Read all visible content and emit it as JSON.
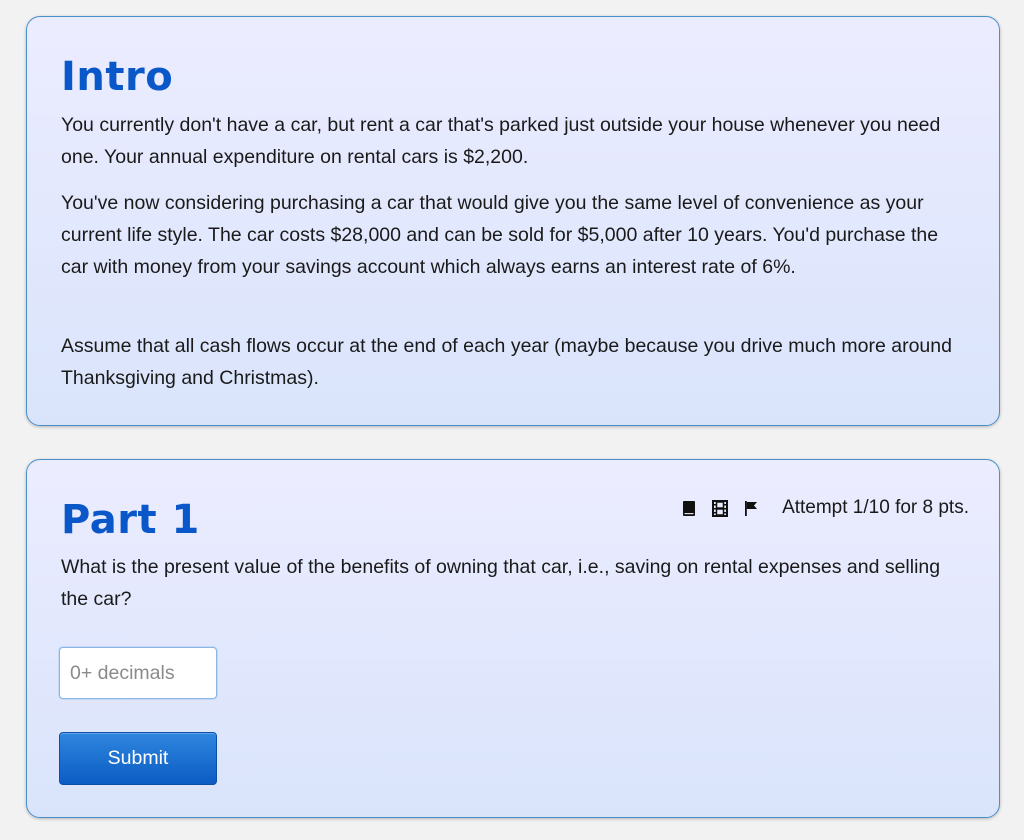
{
  "intro": {
    "title": "Intro",
    "paragraphs": [
      "You currently don't have a car, but rent a car that's parked just outside your house whenever you need one. Your annual expenditure on rental cars is $2,200.",
      "You've now considering purchasing a car that would give you the same level of convenience as your current life style. The car costs $28,000 and can be sold for $5,000 after 10 years. You'd purchase the car with money from your savings account which always earns an interest rate of 6%.",
      "Assume that all cash flows occur at the end of each year (maybe because you drive much more around Thanksgiving and Christmas)."
    ]
  },
  "part1": {
    "title": "Part 1",
    "attempt_text": "Attempt 1/10 for 8 pts.",
    "icons": [
      "book-icon",
      "film-icon",
      "flag-icon"
    ],
    "question": "What is the present value of the benefits of owning that car, i.e., saving on rental expenses and selling the car?",
    "answer_input": {
      "value": "",
      "placeholder": "0+ decimals"
    },
    "submit_label": "Submit"
  },
  "colors": {
    "title": "#0a57c9",
    "card_border": "#4a90c8",
    "card_bg_top": "#ececff",
    "card_bg_bottom": "#d9e4fb",
    "button": "#0b5cc4"
  }
}
